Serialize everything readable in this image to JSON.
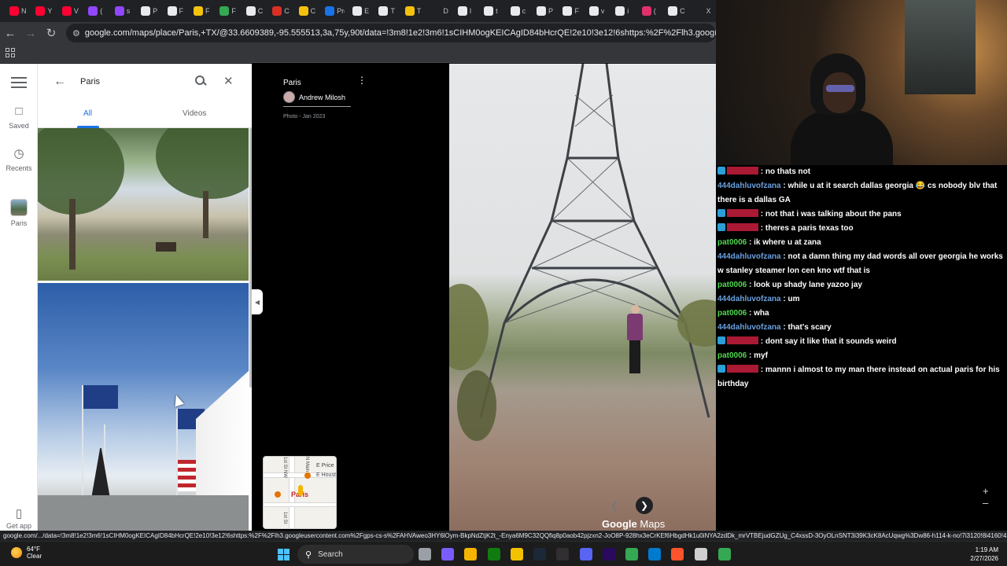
{
  "browser": {
    "tabs": [
      {
        "label": "N",
        "color": "#ff0033"
      },
      {
        "label": "Y",
        "color": "#ff0033"
      },
      {
        "label": "V",
        "color": "#ff0033"
      },
      {
        "label": "(",
        "color": "#9146ff"
      },
      {
        "label": "s",
        "color": "#9146ff"
      },
      {
        "label": "P",
        "color": "#e8eaed"
      },
      {
        "label": "F",
        "color": "#e8eaed"
      },
      {
        "label": "F",
        "color": "#f4c20d"
      },
      {
        "label": "F",
        "color": "#34a853"
      },
      {
        "label": "C",
        "color": "#e8eaed"
      },
      {
        "label": "C",
        "color": "#d93025"
      },
      {
        "label": "C",
        "color": "#f4c20d"
      },
      {
        "label": "Pro",
        "color": "#1a73e8"
      },
      {
        "label": "E",
        "color": "#e8eaed"
      },
      {
        "label": "T",
        "color": "#e8eaed"
      },
      {
        "label": "T",
        "color": "#f4c20d"
      },
      {
        "label": "D",
        "color": "#202124"
      },
      {
        "label": "I",
        "color": "#e8eaed"
      },
      {
        "label": "t",
        "color": "#e8eaed"
      },
      {
        "label": "c",
        "color": "#e8eaed"
      },
      {
        "label": "P",
        "color": "#e8eaed"
      },
      {
        "label": "F",
        "color": "#e8eaed"
      },
      {
        "label": "v",
        "color": "#e8eaed"
      },
      {
        "label": "i",
        "color": "#e8eaed"
      },
      {
        "label": "(",
        "color": "#e1306c"
      },
      {
        "label": "C",
        "color": "#e8eaed"
      },
      {
        "label": "X",
        "color": "#202124"
      }
    ],
    "url": "google.com/maps/place/Paris,+TX/@33.6609389,-95.555513,3a,75y,90t/data=!3m8!1e2!3m6!1sCIHM0ogKEICAgID84bHcrQE!2e10!3e12!6shttps:%2F%2Flh3.googleusercontent.com%2Fgps-cs-s%2F"
  },
  "rail": {
    "saved": "Saved",
    "recents": "Recents",
    "paris": "Paris",
    "get_app": "Get app"
  },
  "search": {
    "query": "Paris",
    "tabs": [
      "All",
      "Videos"
    ]
  },
  "photo": {
    "title": "Paris",
    "author": "Andrew Milosh",
    "date": "Photo - Jan 2023"
  },
  "minimap": {
    "labels": [
      "E Price",
      "E Houst",
      "Paris",
      "N Main S",
      "1st St NW",
      "1st St"
    ]
  },
  "brand": {
    "google": "Google",
    "maps": "Maps"
  },
  "chat": [
    {
      "user": "",
      "text": ": no thats not",
      "color": "#c81e3d",
      "badge": true
    },
    {
      "user": "444dahluvofzana",
      "text": ": while u at it search dallas georgia 😂 cs nobody blv that there is a dallas GA",
      "color": "#6aa0e0",
      "badge": false
    },
    {
      "user": "",
      "text": ": not that i was talking about the pans",
      "color": "#c81e3d",
      "badge": true
    },
    {
      "user": "",
      "text": ": theres a paris texas too",
      "color": "#c81e3d",
      "badge": true
    },
    {
      "user": "pat0006",
      "text": ": ik where u at zana",
      "color": "#4fd84f",
      "badge": false
    },
    {
      "user": "444dahluvofzana",
      "text": ": not a damn thing my dad words all over georgia he works w stanley steamer lon cen kno wtf that is",
      "color": "#6aa0e0",
      "badge": false
    },
    {
      "user": "pat0006",
      "text": ": look up shady lane yazoo jay",
      "color": "#4fd84f",
      "badge": false
    },
    {
      "user": "444dahluvofzana",
      "text": ": um",
      "color": "#6aa0e0",
      "badge": false
    },
    {
      "user": "pat0006",
      "text": ": wha",
      "color": "#4fd84f",
      "badge": false
    },
    {
      "user": "444dahluvofzana",
      "text": ": that's scary",
      "color": "#6aa0e0",
      "badge": false
    },
    {
      "user": "",
      "text": ": dont say it like that it sounds weird",
      "color": "#c81e3d",
      "badge": true
    },
    {
      "user": "pat0006",
      "text": ": myf",
      "color": "#4fd84f",
      "badge": false
    },
    {
      "user": "",
      "text": ": mannn i almost to my man there instead on actual paris for his birthday",
      "color": "#c81e3d",
      "badge": true
    }
  ],
  "status_url": "google.com/.../data=!3m8!1e2!3m6!1sCIHM0ogKEICAgID84bHcrQE!2e10!3e12!6shttps:%2F%2Flh3.googleusercontent.com%2Fgps-cs-s%2FAHVAweo3HY6lOym-BkpNdZtjK2t_-Enya6M9C32QQfiq8p0aob42pjzxn2-JoO8P-928hx3eCrKEf6HbgdHk1u0iNYA2zdDk_mrVTBEjudGZUg_C4xssD-3OyOLnSNT3i39K3cK8AcUqwg%3Dw86-h114-k-no!7i3120!8i4160!4...",
  "taskbar": {
    "temp": "64°F",
    "condition": "Clear",
    "search": "Search",
    "time": "1:19 AM",
    "date": "2/27/2026",
    "apps": [
      {
        "name": "task-view",
        "color": "#9aa0a6"
      },
      {
        "name": "copilot",
        "color": "#7a5cfa"
      },
      {
        "name": "store",
        "color": "#f4b400"
      },
      {
        "name": "xbox",
        "color": "#107c10"
      },
      {
        "name": "file-explorer",
        "color": "#f2c200"
      },
      {
        "name": "steam",
        "color": "#1b2838"
      },
      {
        "name": "obs",
        "color": "#302e31"
      },
      {
        "name": "discord",
        "color": "#5865f2"
      },
      {
        "name": "premiere",
        "color": "#2a0a5e"
      },
      {
        "name": "chrome",
        "color": "#34a853"
      },
      {
        "name": "vscode",
        "color": "#007acc"
      },
      {
        "name": "brave",
        "color": "#fb542b"
      },
      {
        "name": "ccleaner",
        "color": "#cfcfcf"
      },
      {
        "name": "chrome-active",
        "color": "#34a853"
      }
    ]
  }
}
